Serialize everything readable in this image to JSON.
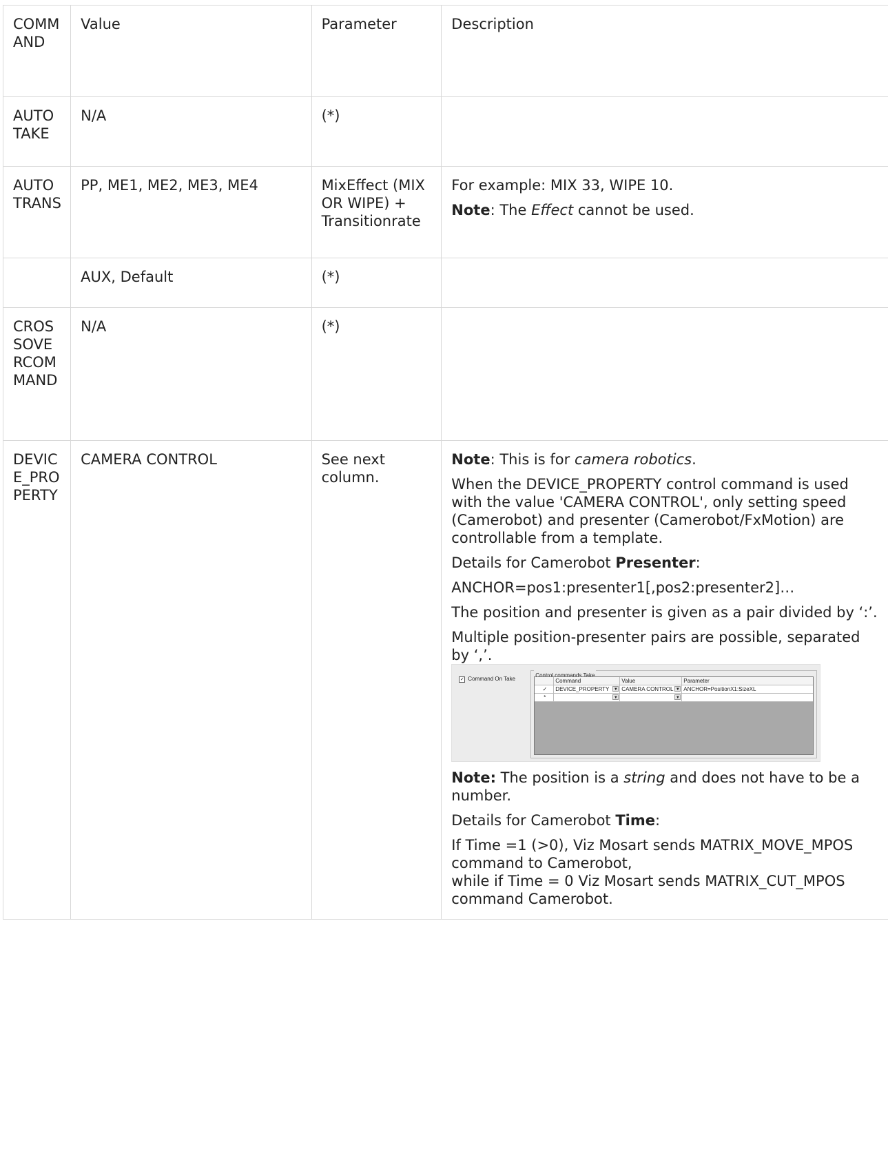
{
  "headers": {
    "command": "COMMAND",
    "value": "Value",
    "parameter": "Parameter",
    "description": "Description"
  },
  "rows": {
    "autotake": {
      "command": "AUTOTAKE",
      "value": "N/A",
      "parameter": "(*)"
    },
    "autotrans": {
      "command": "AUTOTRANS",
      "value": "PP, ME1, ME2, ME3, ME4",
      "parameter": "MixEffect (MIX OR WIPE) + Transitionrate",
      "desc": {
        "line1": "For example: MIX 33, WIPE 10.",
        "note_label": "Note",
        "note_pre": ": The ",
        "note_em": "Effect",
        "note_post": " cannot be used."
      }
    },
    "aux": {
      "value": "AUX, Default",
      "parameter": "(*)"
    },
    "crossover": {
      "command": "CROSSOVERCOMMAND",
      "value": "N/A",
      "parameter": "(*)"
    },
    "device": {
      "command": "DEVICE_PROPERTY",
      "value": "CAMERA CONTROL",
      "parameter": "See next column.",
      "desc": {
        "note1_label": "Note",
        "note1_pre": ": This is for ",
        "note1_em": "camera robotics",
        "note1_post": ".",
        "p2": "When the DEVICE_PROPERTY control command is used with the value 'CAMERA CONTROL', only setting speed (Camerobot) and presenter (Camerobot/FxMotion) are controllable from a template.",
        "p3_pre": "Details for Camerobot ",
        "p3_bold": "Presenter",
        "p3_post": ":",
        "p4": "ANCHOR=pos1:presenter1[,pos2:presenter2]…",
        "p5": "The position and presenter is given as a pair divided by ‘:’.",
        "p6": "Multiple position-presenter pairs are possible, separated by ‘,’.",
        "note2_label": "Note:",
        "note2_pre": " The position is a ",
        "note2_em": "string",
        "note2_post": " and does not have to be a number.",
        "p8_pre": "Details for Camerobot ",
        "p8_bold": "Time",
        "p8_post": ":",
        "p9a": "If Time =1 (>0), Viz Mosart sends MATRIX_MOVE_MPOS command to Camerobot,",
        "p9b": "while if Time = 0 Viz Mosart sends MATRIX_CUT_MPOS command Camerobot."
      },
      "screenshot": {
        "checkbox_label": "Command On Take",
        "group_title": "Control commands Take",
        "col_command": "Command",
        "col_value": "Value",
        "col_parameter": "Parameter",
        "row1_marker": "✓",
        "row1_command": "DEVICE_PROPERTY",
        "row1_value": "CAMERA CONTROL",
        "row1_parameter": "ANCHOR=PositionX1:SizeXL",
        "row2_marker": "*"
      }
    }
  }
}
